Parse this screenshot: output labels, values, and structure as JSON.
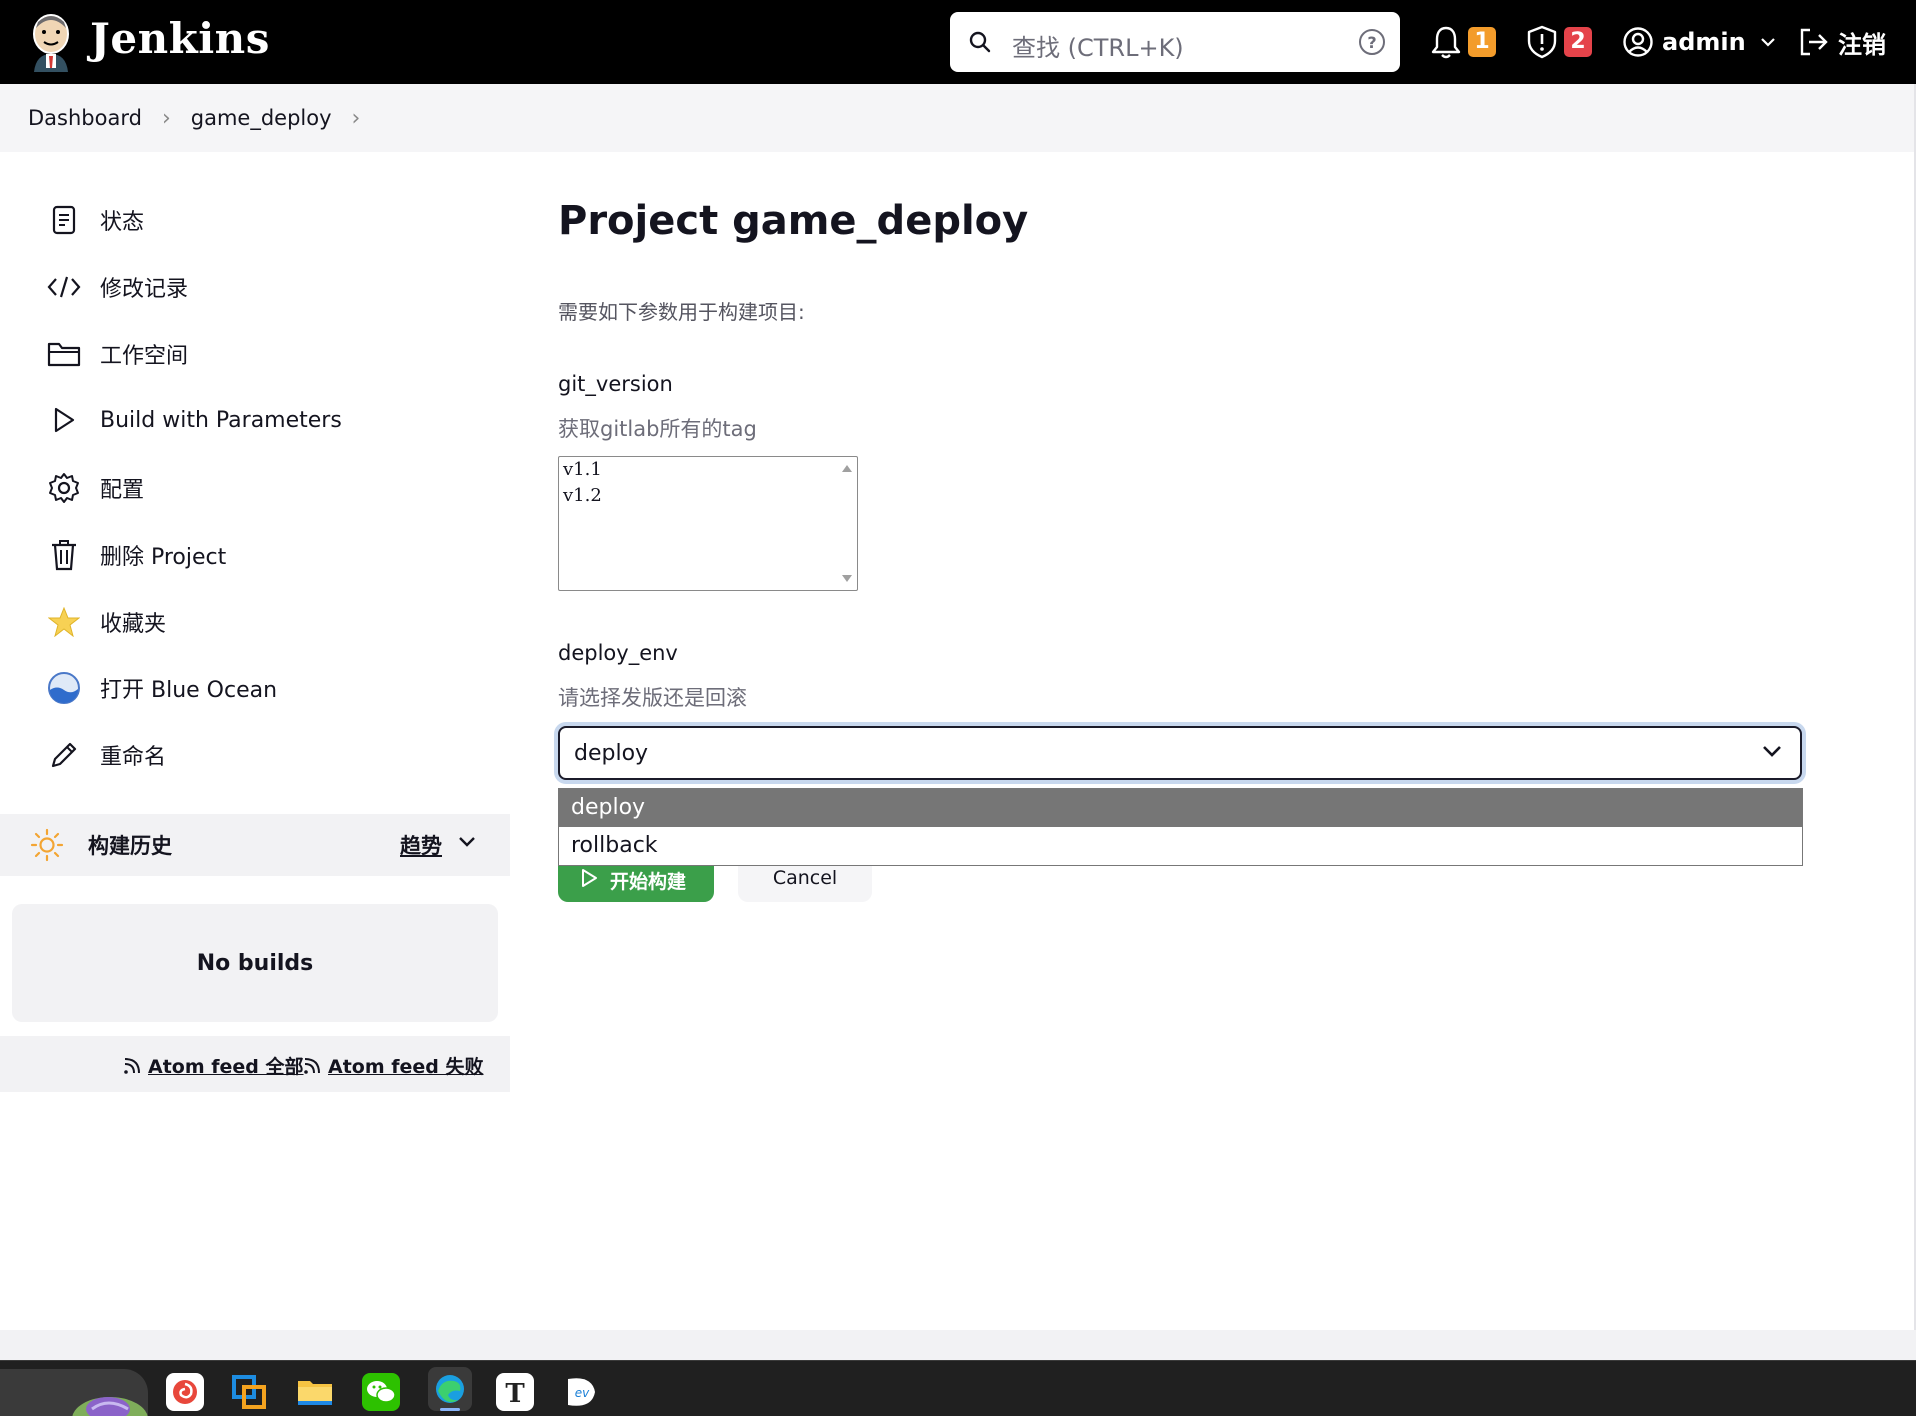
{
  "header": {
    "brand": "Jenkins",
    "search_placeholder": "查找 (CTRL+K)",
    "notifications_count": "1",
    "security_count": "2",
    "user": "admin",
    "logout": "注销"
  },
  "breadcrumb": {
    "items": [
      "Dashboard",
      "game_deploy"
    ]
  },
  "sidebar": {
    "items": [
      {
        "label": "状态",
        "icon": "notepad-icon"
      },
      {
        "label": "修改记录",
        "icon": "code-icon"
      },
      {
        "label": "工作空间",
        "icon": "folder-icon"
      },
      {
        "label": "Build with Parameters",
        "icon": "play-icon"
      },
      {
        "label": "配置",
        "icon": "gear-icon"
      },
      {
        "label": "删除 Project",
        "icon": "trash-icon"
      },
      {
        "label": "收藏夹",
        "icon": "star-icon"
      },
      {
        "label": "打开 Blue Ocean",
        "icon": "blue-ocean-icon"
      },
      {
        "label": "重命名",
        "icon": "pencil-icon"
      }
    ],
    "history": {
      "title": "构建历史",
      "trend": "趋势",
      "empty": "No builds",
      "feed_all": "Atom feed 全部",
      "feed_failed": "Atom feed 失败"
    }
  },
  "main": {
    "title": "Project game_deploy",
    "intro": "需要如下参数用于构建项目:",
    "params": [
      {
        "name": "git_version",
        "description": "获取gitlab所有的tag",
        "options": [
          "v1.1",
          "v1.2"
        ]
      },
      {
        "name": "deploy_env",
        "description": "请选择发版还是回滚",
        "selected": "deploy",
        "options": [
          "deploy",
          "rollback"
        ]
      }
    ],
    "build_button": "开始构建",
    "cancel_button": "Cancel"
  },
  "colors": {
    "header_bg": "#000000",
    "build_green": "#3b9f4a",
    "badge_orange": "#f39c2b",
    "badge_red": "#e5434a",
    "dropdown_selected": "#767676"
  }
}
